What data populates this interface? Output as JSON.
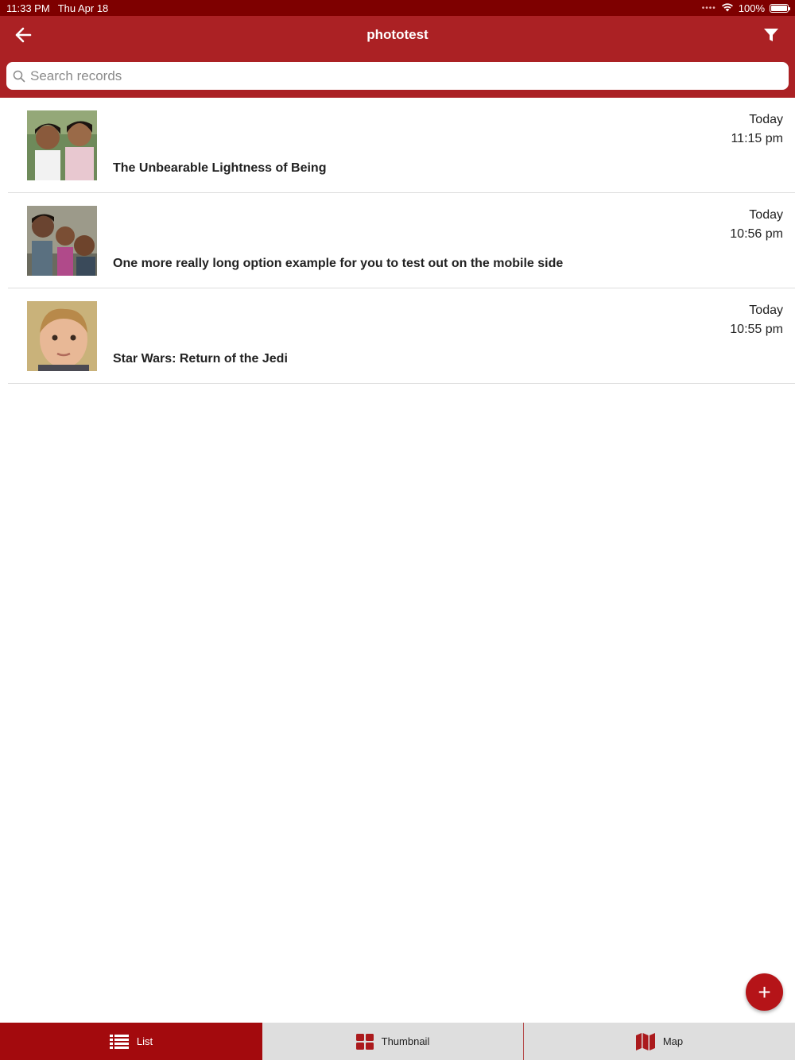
{
  "status": {
    "time": "11:33 PM",
    "date": "Thu Apr 18",
    "signal": "••••",
    "battery": "100%"
  },
  "nav": {
    "title": "phototest",
    "back_icon": "arrow-left-icon",
    "filter_icon": "filter-icon"
  },
  "search": {
    "placeholder": "Search records",
    "value": ""
  },
  "records": [
    {
      "title": "The Unbearable Lightness of Being",
      "day": "Today",
      "time": "11:15 pm"
    },
    {
      "title": "One more really long option example for you to test out on the mobile side",
      "day": "Today",
      "time": "10:56 pm"
    },
    {
      "title": "Star Wars: Return of the Jedi",
      "day": "Today",
      "time": "10:55 pm"
    }
  ],
  "fab": {
    "label": "+"
  },
  "tabs": [
    {
      "label": "List",
      "icon": "list-icon",
      "active": true
    },
    {
      "label": "Thumbnail",
      "icon": "grid-icon",
      "active": false
    },
    {
      "label": "Map",
      "icon": "map-icon",
      "active": false
    }
  ],
  "colors": {
    "status_bar": "#7e0000",
    "nav_bar": "#ab2124",
    "active_tab": "#a30a0d",
    "fab": "#b51418"
  }
}
